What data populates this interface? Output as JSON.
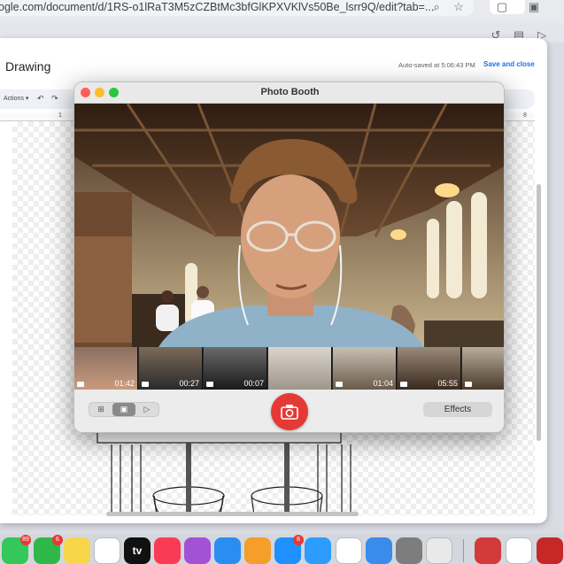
{
  "browser": {
    "url": "ogle.com/document/d/1RS-o1lRaT3M5zCZBtMc3bfGlKPXVKlVs50Be_lsrr9Q/edit?tab=...",
    "icons": [
      "zoom-icon",
      "star-icon",
      "extension-icon",
      "puzzle-icon"
    ]
  },
  "drawing_dialog": {
    "title": "Drawing",
    "autosave": "Auto-saved at 5:06:43 PM",
    "save_close": "Save and close",
    "toolbar": {
      "actions": "Actions ▾",
      "undo": "↶",
      "redo": "↷"
    },
    "ruler": {
      "left": "1",
      "right": "8"
    }
  },
  "photo_booth": {
    "title": "Photo Booth",
    "thumbnails": [
      {
        "duration": "01:42"
      },
      {
        "duration": "00:27"
      },
      {
        "duration": "00:07"
      },
      {
        "duration": ""
      },
      {
        "duration": "01:04"
      },
      {
        "duration": "05:55"
      },
      {
        "duration": ""
      }
    ],
    "modes": [
      "⊞",
      "▣",
      "▷"
    ],
    "selected_mode": 1,
    "effects_label": "Effects"
  },
  "dock": {
    "apps": [
      {
        "name": "Messages",
        "color": "#34c759",
        "badge": "89"
      },
      {
        "name": "FaceTime",
        "color": "#2fb84a",
        "badge": "6"
      },
      {
        "name": "Notes",
        "color": "#f7d64a",
        "badge": ""
      },
      {
        "name": "Freeform",
        "color": "#ffffff",
        "badge": ""
      },
      {
        "name": "TV",
        "color": "#111111",
        "label": "tv",
        "badge": ""
      },
      {
        "name": "Music",
        "color": "#fa3b55",
        "badge": ""
      },
      {
        "name": "Podcasts",
        "color": "#a352d6",
        "badge": ""
      },
      {
        "name": "Keynote",
        "color": "#2a8df0",
        "badge": ""
      },
      {
        "name": "Pages",
        "color": "#f59e2a",
        "badge": ""
      },
      {
        "name": "App Store",
        "color": "#1e90ff",
        "badge": "8"
      },
      {
        "name": "Safari",
        "color": "#2d9cff",
        "badge": ""
      },
      {
        "name": "Chrome",
        "color": "#ffffff",
        "badge": ""
      },
      {
        "name": "Mail",
        "color": "#3b8bea",
        "badge": ""
      },
      {
        "name": "System Settings",
        "color": "#7d7d7d",
        "badge": ""
      },
      {
        "name": "iPhone Mirroring",
        "color": "#e9e9e9",
        "badge": ""
      },
      {
        "name": "Photo Booth",
        "color": "#d33a3a",
        "badge": ""
      },
      {
        "name": "ChatGPT",
        "color": "#ffffff",
        "badge": ""
      },
      {
        "name": "Photo Booth Active",
        "color": "#c62828",
        "badge": ""
      }
    ]
  }
}
